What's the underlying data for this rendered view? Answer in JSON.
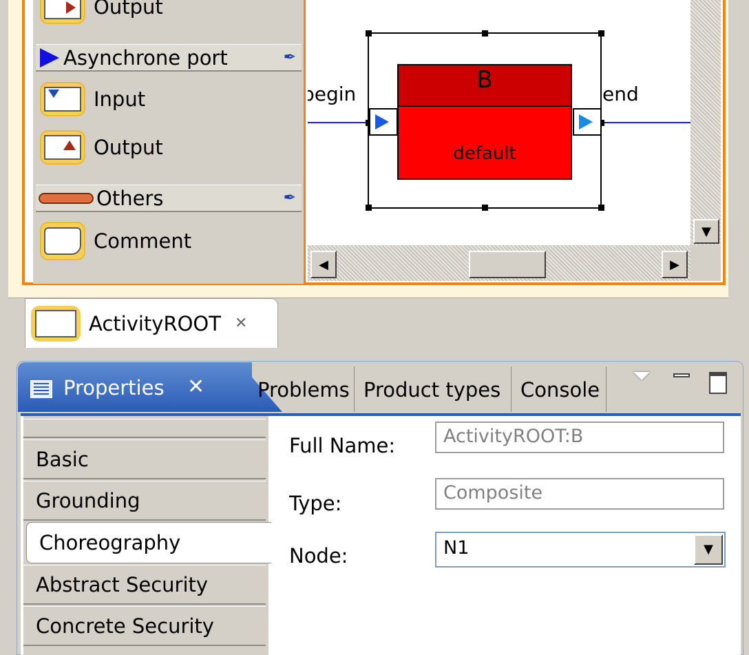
{
  "palette": {
    "items": [
      {
        "label": "Output",
        "type": "tool",
        "icon": "output-port-icon"
      },
      {
        "label": "Asynchrone port",
        "type": "drawer",
        "icon": "play-arrow-icon"
      },
      {
        "label": "Input",
        "type": "tool",
        "icon": "input-port-icon"
      },
      {
        "label": "Output",
        "type": "tool",
        "icon": "output-port-icon"
      },
      {
        "label": "Others",
        "type": "drawer",
        "icon": "pill-icon"
      },
      {
        "label": "Comment",
        "type": "tool",
        "icon": "comment-icon"
      }
    ]
  },
  "diagram": {
    "node_title": "B",
    "node_subtitle": "default",
    "left_port_label": "begin",
    "right_port_label": "end",
    "node_header_color": "#cc0000",
    "node_body_color": "#ff0000"
  },
  "editor_tab": {
    "label": "ActivityROOT",
    "close_glyph": "✕"
  },
  "views": {
    "tabs": [
      {
        "label": "Properties",
        "active": true
      },
      {
        "label": "Problems",
        "active": false
      },
      {
        "label": "Product types",
        "active": false
      },
      {
        "label": "Console",
        "active": false
      }
    ]
  },
  "properties": {
    "sidebar": [
      "",
      "Basic",
      "Grounding",
      "Choreography",
      "Abstract Security",
      "Concrete Security"
    ],
    "selected": "Choreography",
    "fields": {
      "full_name_label": "Full Name:",
      "full_name_value": "ActivityROOT:B",
      "type_label": "Type:",
      "type_value": "Composite",
      "node_label": "Node:",
      "node_value": "N1"
    }
  },
  "colors": {
    "accent": "#f5820b",
    "active_tab": "#2a5cb5"
  }
}
